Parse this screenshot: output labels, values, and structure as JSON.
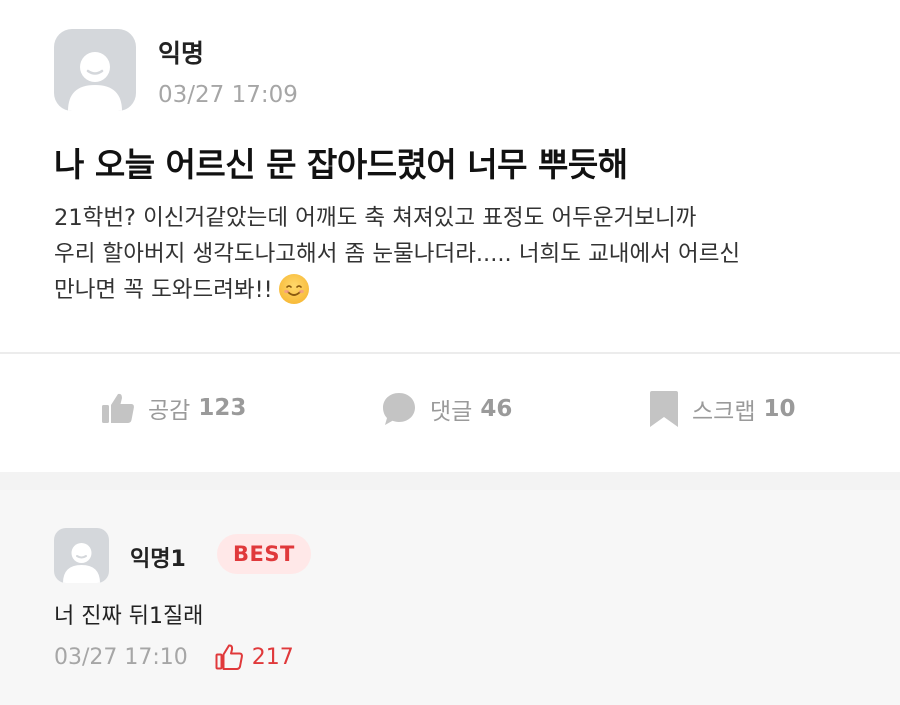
{
  "post": {
    "author": "익명",
    "time": "03/27 17:09",
    "title": "나 오늘 어르신 문 잡아드렸어 너무 뿌듯해",
    "body_lines": [
      "21학번? 이신거같았는데 어깨도 축 쳐져있고 표정도 어두운거보니까",
      "우리 할아버지 생각도나고해서 좀 눈물나더라..... 너희도 교내에서 어르신",
      "만나면 꼭 도와드려봐!!"
    ],
    "emoji": "smiling-face-icon"
  },
  "actions": {
    "like": {
      "label": "공감",
      "count": "123",
      "icon": "thumbs-up-icon"
    },
    "comment": {
      "label": "댓글",
      "count": "46",
      "icon": "speech-bubble-icon"
    },
    "scrap": {
      "label": "스크랩",
      "count": "10",
      "icon": "bookmark-icon"
    }
  },
  "comment": {
    "author": "익명1",
    "badge": "BEST",
    "body": "너 진짜 뒤1질래",
    "time": "03/27 17:10",
    "likes": "217"
  },
  "colors": {
    "accent_red": "#e0393b",
    "muted_gray": "#9a9a9a",
    "avatar_gray": "#d4d7db"
  }
}
